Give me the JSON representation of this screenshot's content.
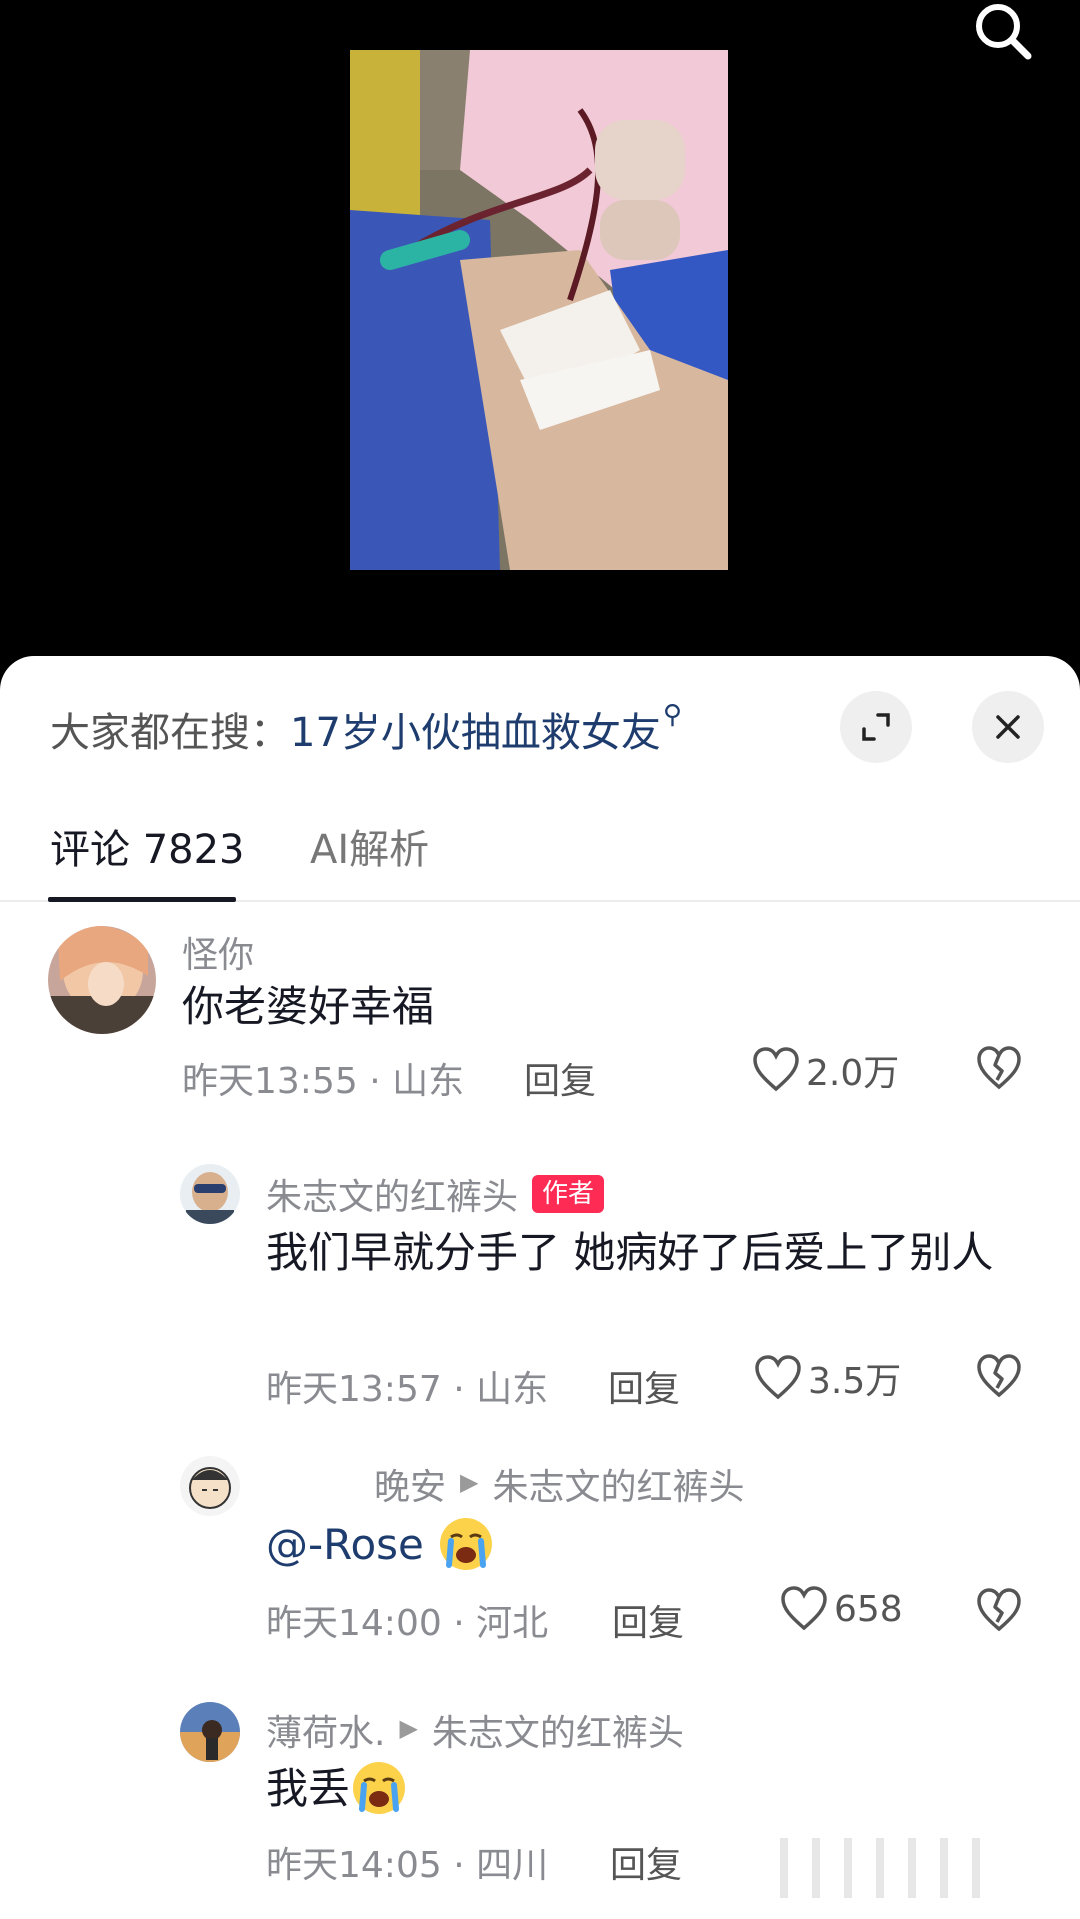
{
  "header": {
    "search_icon": "search-icon"
  },
  "sheet": {
    "search_prefix": "大家都在搜：",
    "search_term": "17岁小伙抽血救女友",
    "search_term_icon": "search-icon",
    "expand_icon": "expand-icon",
    "close_icon": "close-icon"
  },
  "tabs": [
    {
      "label": "评论 7823",
      "active": true
    },
    {
      "label": "AI解析",
      "active": false
    }
  ],
  "comments": [
    {
      "author": "怪你",
      "text": "你老婆好幸福",
      "time": "昨天13:55 · 山东",
      "reply_label": "回复",
      "likes": "2.0万"
    },
    {
      "author": "朱志文的红裤头",
      "badge": "作者",
      "text": "我们早就分手了 她病好了后爱上了别人",
      "time": "昨天13:57 · 山东",
      "reply_label": "回复",
      "likes": "3.5万"
    },
    {
      "author": "晚安",
      "reply_to": "朱志文的红裤头",
      "mention": "@-Rose",
      "emoji": "crying-face",
      "time": "昨天14:00 · 河北",
      "reply_label": "回复",
      "likes": "658"
    },
    {
      "author": "薄荷水.",
      "reply_to": "朱志文的红裤头",
      "text": "我丢",
      "emoji": "crying-face",
      "time": "昨天14:05 · 四川",
      "reply_label": "回复"
    }
  ],
  "colors": {
    "accent_link": "#1e3d6e",
    "badge_red": "#fe2c55",
    "text_primary": "#161823",
    "text_secondary": "#8a8b91"
  }
}
